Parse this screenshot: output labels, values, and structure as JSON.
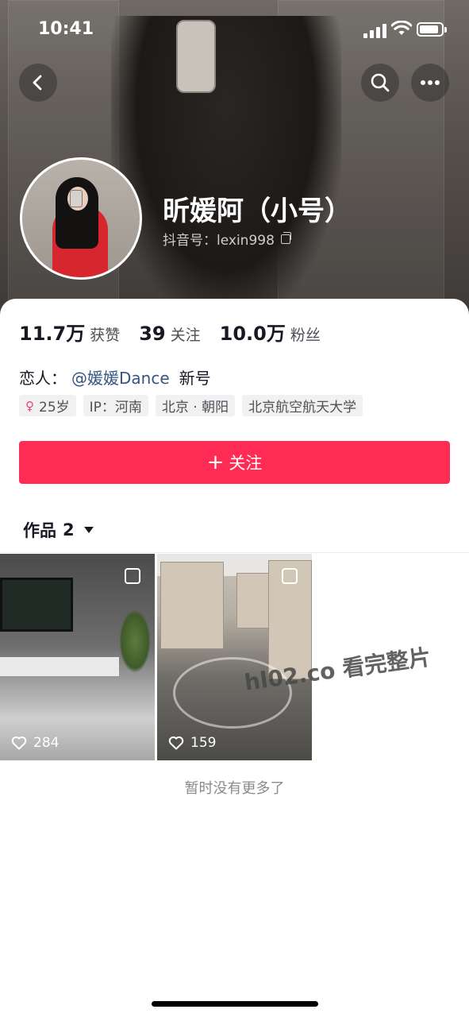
{
  "status_bar": {
    "time": "10:41"
  },
  "profile": {
    "name": "昕媛阿（小号）",
    "douyin_id": "抖音号：lexin998",
    "stats": [
      {
        "value": "11.7万",
        "label": "获赞"
      },
      {
        "value": "39",
        "label": "关注"
      },
      {
        "value": "10.0万",
        "label": "粉丝"
      }
    ],
    "bio": {
      "prefix": "恋人：",
      "mention": "@媛媛Dance",
      "suffix": "新号"
    },
    "tags": {
      "gender_icon": "♀",
      "age": "25岁",
      "ip": "IP：河南",
      "location": "北京 · 朝阳",
      "school": "北京航空航天大学"
    },
    "follow_label": "关注",
    "accent_color": "#fe2c55"
  },
  "works": {
    "label": "作品",
    "count": "2",
    "items": [
      {
        "likes": "284"
      },
      {
        "likes": "159"
      }
    ],
    "end_text": "暂时没有更多了"
  },
  "watermark": "hl02.co 看完整片",
  "icons": [
    "back-icon",
    "search-icon",
    "more-icon",
    "copy-icon",
    "female-icon",
    "plus-icon",
    "caret-down-icon",
    "heart-icon",
    "multi-image-icon"
  ]
}
